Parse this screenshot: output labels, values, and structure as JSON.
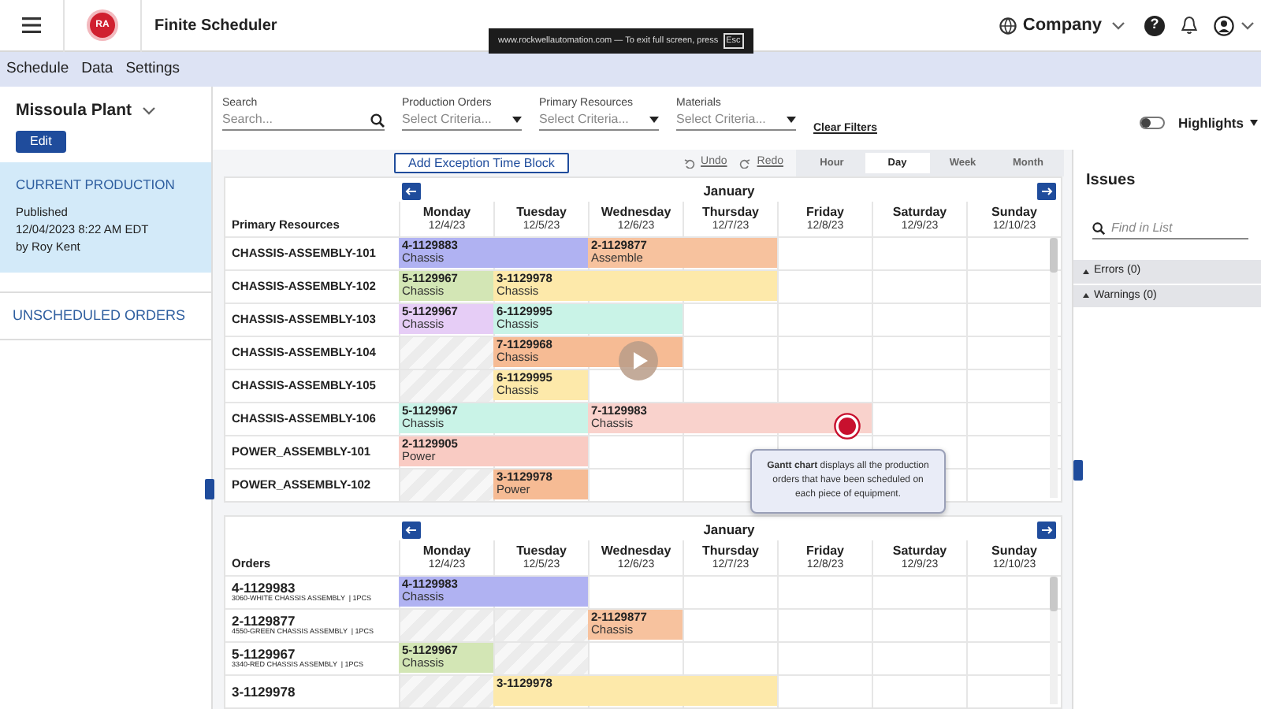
{
  "fullscreen_notice": {
    "text": "www.rockwellautomation.com — To exit full screen, press",
    "key": "Esc"
  },
  "header": {
    "logo_text": "RA",
    "app_title": "Finite Scheduler",
    "company": "Company",
    "help": "?"
  },
  "menu": [
    {
      "label": "Schedule"
    },
    {
      "label": "Data"
    },
    {
      "label": "Settings"
    }
  ],
  "sidebar": {
    "plant": "Missoula Plant",
    "edit_button": "Edit",
    "sections": [
      {
        "kind": "production",
        "title": "CURRENT PRODUCTION",
        "lines": [
          "Published",
          "12/04/2023 8:22 AM EDT",
          "by Roy Kent"
        ],
        "selected": true
      },
      {
        "kind": "link",
        "title": "UNSCHEDULED ORDERS",
        "selected": false
      }
    ]
  },
  "filters": [
    {
      "kind": "search",
      "label": "Search",
      "placeholder": "Search..."
    },
    {
      "kind": "select",
      "label": "Production Orders",
      "placeholder": "Select Criteria..."
    },
    {
      "kind": "select",
      "label": "Primary Resources",
      "placeholder": "Select Criteria..."
    },
    {
      "kind": "select",
      "label": "Materials",
      "placeholder": "Select Criteria..."
    }
  ],
  "clear_filters": "Clear Filters",
  "highlights": {
    "label": "Highlights",
    "on": false
  },
  "toolbar": {
    "add_button": "Add Exception Time Block",
    "undo": "Undo",
    "redo": "Redo",
    "views": [
      {
        "label": "Hour",
        "selected": false
      },
      {
        "label": "Day",
        "selected": true
      },
      {
        "label": "Week",
        "selected": false
      },
      {
        "label": "Month",
        "selected": false
      }
    ]
  },
  "resource_gantt": {
    "month": "January",
    "row_header": "Primary Resources",
    "days": [
      {
        "name": "Monday",
        "date": "12/4/23"
      },
      {
        "name": "Tuesday",
        "date": "12/5/23"
      },
      {
        "name": "Wednesday",
        "date": "12/6/23"
      },
      {
        "name": "Thursday",
        "date": "12/7/23"
      },
      {
        "name": "Friday",
        "date": "12/8/23"
      },
      {
        "name": "Saturday",
        "date": "12/9/23"
      },
      {
        "name": "Sunday",
        "date": "12/10/23"
      }
    ],
    "rows": [
      {
        "name": "CHASSIS-ASSEMBLY-101",
        "cells": [
          {
            "kind": "bar",
            "order": "4-1129883",
            "part": "Chassis",
            "color": "#b0b2f2"
          },
          {
            "kind": "continued"
          },
          {
            "kind": "bar",
            "order": "2-1129877",
            "part": "Assemble",
            "color": "#f7c29e"
          },
          {
            "kind": "continued"
          },
          {
            "kind": "empty"
          },
          {
            "kind": "empty"
          },
          {
            "kind": "empty"
          }
        ]
      },
      {
        "name": "CHASSIS-ASSEMBLY-102",
        "cells": [
          {
            "kind": "bar",
            "order": "5-1129967",
            "part": "Chassis",
            "color": "#d3e6b5"
          },
          {
            "kind": "bar",
            "order": "3-1129978",
            "part": "Chassis",
            "color": "#fde9aa"
          },
          {
            "kind": "continued"
          },
          {
            "kind": "continued"
          },
          {
            "kind": "empty"
          },
          {
            "kind": "empty"
          },
          {
            "kind": "empty"
          }
        ]
      },
      {
        "name": "CHASSIS-ASSEMBLY-103",
        "cells": [
          {
            "kind": "bar",
            "order": "5-1129967",
            "part": "Chassis",
            "color": "#e6cdf6"
          },
          {
            "kind": "bar",
            "order": "6-1129995",
            "part": "Chassis",
            "color": "#c9f3e7"
          },
          {
            "kind": "continued"
          },
          {
            "kind": "empty"
          },
          {
            "kind": "empty"
          },
          {
            "kind": "empty"
          },
          {
            "kind": "empty"
          }
        ]
      },
      {
        "name": "CHASSIS-ASSEMBLY-104",
        "cells": [
          {
            "kind": "blocked"
          },
          {
            "kind": "bar",
            "order": "7-1129968",
            "part": "Chassis",
            "color": "#f6bb94"
          },
          {
            "kind": "continued"
          },
          {
            "kind": "empty"
          },
          {
            "kind": "empty"
          },
          {
            "kind": "empty"
          },
          {
            "kind": "empty"
          }
        ]
      },
      {
        "name": "CHASSIS-ASSEMBLY-105",
        "cells": [
          {
            "kind": "blocked"
          },
          {
            "kind": "bar",
            "order": "6-1129995",
            "part": "Chassis",
            "color": "#fde9aa"
          },
          {
            "kind": "empty"
          },
          {
            "kind": "empty"
          },
          {
            "kind": "empty"
          },
          {
            "kind": "empty"
          },
          {
            "kind": "empty"
          }
        ]
      },
      {
        "name": "CHASSIS-ASSEMBLY-106",
        "cells": [
          {
            "kind": "bar",
            "order": "5-1129967",
            "part": "Chassis",
            "color": "#c9f3e7"
          },
          {
            "kind": "continued"
          },
          {
            "kind": "bar",
            "order": "7-1129983",
            "part": "Chassis",
            "color": "#f9d2cc"
          },
          {
            "kind": "continued"
          },
          {
            "kind": "continued"
          },
          {
            "kind": "empty"
          },
          {
            "kind": "empty"
          }
        ]
      },
      {
        "name": "POWER_ASSEMBLY-101",
        "cells": [
          {
            "kind": "bar",
            "order": "2-1129905",
            "part": "Power",
            "color": "#f9cbc3"
          },
          {
            "kind": "continued"
          },
          {
            "kind": "empty"
          },
          {
            "kind": "empty"
          },
          {
            "kind": "empty"
          },
          {
            "kind": "empty"
          },
          {
            "kind": "empty"
          }
        ]
      },
      {
        "name": "POWER_ASSEMBLY-102",
        "cells": [
          {
            "kind": "blocked"
          },
          {
            "kind": "bar",
            "order": "3-1129978",
            "part": "Power",
            "color": "#f6bb94"
          },
          {
            "kind": "empty"
          },
          {
            "kind": "empty"
          },
          {
            "kind": "empty"
          },
          {
            "kind": "empty"
          },
          {
            "kind": "empty"
          }
        ]
      }
    ]
  },
  "order_gantt": {
    "month": "January",
    "row_header": "Orders",
    "days": [
      {
        "name": "Monday",
        "date": "12/4/23"
      },
      {
        "name": "Tuesday",
        "date": "12/5/23"
      },
      {
        "name": "Wednesday",
        "date": "12/6/23"
      },
      {
        "name": "Thursday",
        "date": "12/7/23"
      },
      {
        "name": "Friday",
        "date": "12/8/23"
      },
      {
        "name": "Saturday",
        "date": "12/9/23"
      },
      {
        "name": "Sunday",
        "date": "12/10/23"
      }
    ],
    "rows": [
      {
        "name": "4-1129983",
        "detail": "3060-WHITE CHASSIS ASSEMBLY  | 1PCS",
        "cells": [
          {
            "kind": "bar",
            "order": "4-1129983",
            "part": "Chassis",
            "color": "#b0b2f2"
          },
          {
            "kind": "continued"
          },
          {
            "kind": "empty"
          },
          {
            "kind": "empty"
          },
          {
            "kind": "empty"
          },
          {
            "kind": "empty"
          },
          {
            "kind": "empty"
          }
        ]
      },
      {
        "name": "2-1129877",
        "detail": "4550-GREEN CHASSIS ASSEMBLY  | 1PCS",
        "cells": [
          {
            "kind": "blocked"
          },
          {
            "kind": "blocked"
          },
          {
            "kind": "bar",
            "order": "2-1129877",
            "part": "Chassis",
            "color": "#f7c29e"
          },
          {
            "kind": "empty"
          },
          {
            "kind": "empty"
          },
          {
            "kind": "empty"
          },
          {
            "kind": "empty"
          }
        ]
      },
      {
        "name": "5-1129967",
        "detail": "3340-RED CHASSIS ASSEMBLY  | 1PCS",
        "cells": [
          {
            "kind": "bar",
            "order": "5-1129967",
            "part": "Chassis",
            "color": "#d3e6b5"
          },
          {
            "kind": "blocked"
          },
          {
            "kind": "empty"
          },
          {
            "kind": "empty"
          },
          {
            "kind": "empty"
          },
          {
            "kind": "empty"
          },
          {
            "kind": "empty"
          }
        ]
      },
      {
        "name": "3-1129978",
        "cells": [
          {
            "kind": "blocked"
          },
          {
            "kind": "bar",
            "order": "3-1129978",
            "color": "#fde9aa"
          },
          {
            "kind": "continued"
          },
          {
            "kind": "continued"
          },
          {
            "kind": "empty"
          },
          {
            "kind": "empty"
          },
          {
            "kind": "empty"
          }
        ]
      }
    ]
  },
  "tooltip": {
    "text": "**Gantt chart** displays all the production orders that have been scheduled on each piece of equipment."
  },
  "issues": {
    "title": "Issues",
    "search_placeholder": "Find in List",
    "groups": [
      {
        "label": "Errors (0)"
      },
      {
        "label": "Warnings (0)"
      }
    ]
  }
}
